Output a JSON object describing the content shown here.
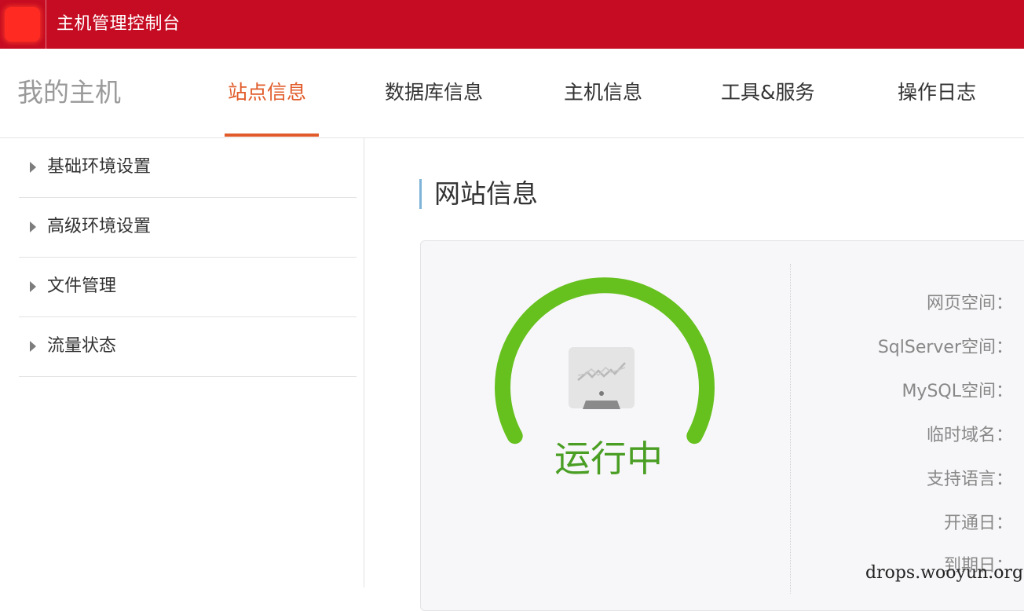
{
  "header": {
    "title": "主机管理控制台",
    "bg_color": "#c60c22"
  },
  "nav": {
    "brand": "我的主机",
    "tabs": [
      {
        "label": "站点信息",
        "active": true
      },
      {
        "label": "数据库信息",
        "active": false
      },
      {
        "label": "主机信息",
        "active": false
      },
      {
        "label": "工具&服务",
        "active": false
      },
      {
        "label": "操作日志",
        "active": false
      }
    ],
    "active_color": "#e15b2a"
  },
  "sidebar": {
    "items": [
      {
        "label": "基础环境设置"
      },
      {
        "label": "高级环境设置"
      },
      {
        "label": "文件管理"
      },
      {
        "label": "流量状态"
      }
    ]
  },
  "content": {
    "section_title": "网站信息",
    "status": {
      "text": "运行中",
      "color": "#4a9e24",
      "gauge_color": "#66c01e",
      "icon": "monitor-chart-icon"
    },
    "info_labels": [
      "网页空间：",
      "SqlServer空间：",
      "MySQL空间：",
      "临时域名：",
      "支持语言：",
      "开通日：",
      "到期日："
    ]
  },
  "watermark": "drops.wooyun.org"
}
